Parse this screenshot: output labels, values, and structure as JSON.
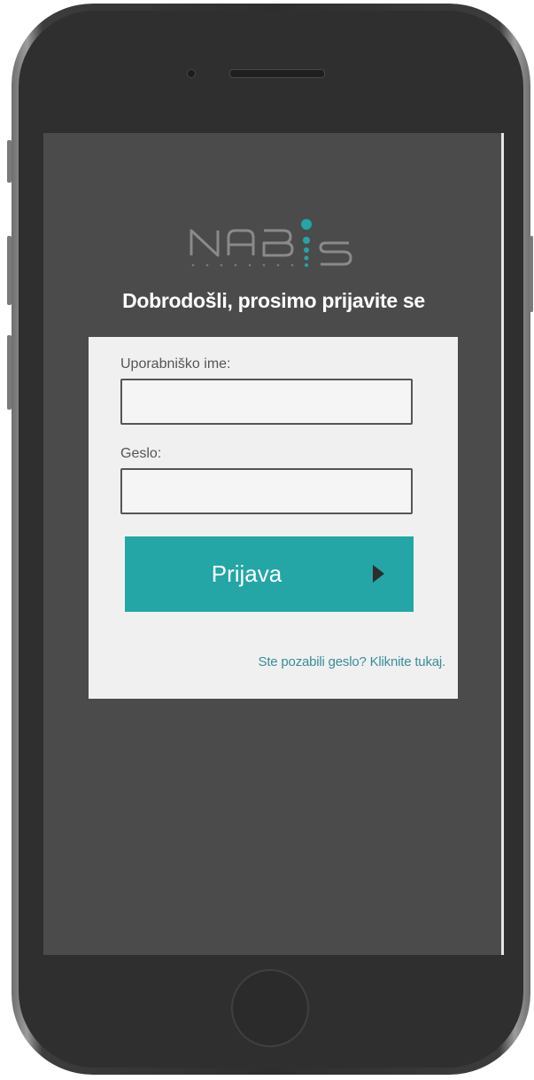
{
  "logo": {
    "text_left": "NAB",
    "text_right": "S",
    "accent_color": "#23a6a5",
    "text_color": "#8a8a8a"
  },
  "login": {
    "welcome": "Dobrodošli, prosimo prijavite se",
    "username_label": "Uporabniško ime:",
    "username_value": "",
    "password_label": "Geslo:",
    "password_value": "",
    "submit_label": "Prijava",
    "forgot_link": "Ste pozabili geslo? Kliknite tukaj."
  },
  "colors": {
    "screen_background": "#4b4b4b",
    "card_background": "#f0f0f0",
    "button_color": "#23a6a5",
    "link_color": "#3b8c98"
  }
}
